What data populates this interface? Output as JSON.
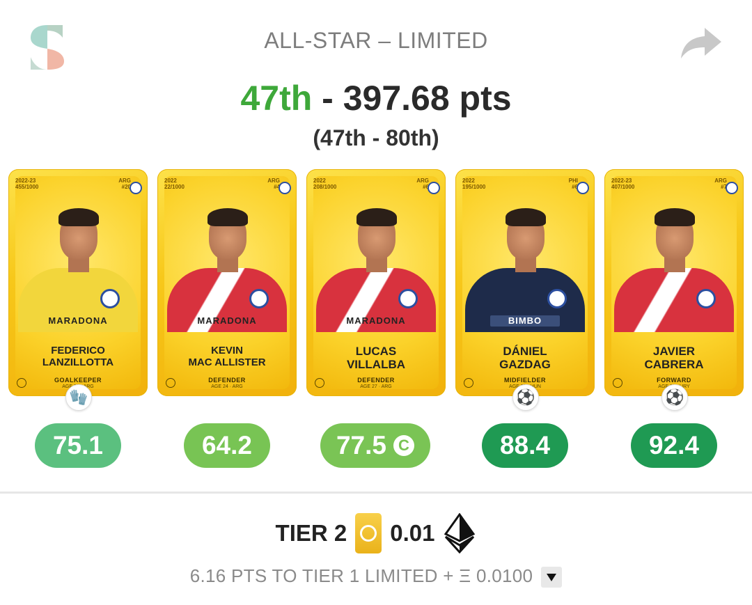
{
  "header": {
    "title": "ALL-STAR – LIMITED",
    "rank": "47th",
    "separator": " - ",
    "points": "397.68 pts",
    "range": "(47th - 80th)"
  },
  "cards": [
    {
      "season": "2022-23",
      "serial": "455/1000",
      "nation": "ARG",
      "number": "#20",
      "name_line1": "FEDERICO",
      "name_line2": "LANZILLOTTA",
      "position": "GOALKEEPER",
      "age": "AGE 32 · ARG",
      "kit": "yellow",
      "sponsor": "MARADONA",
      "score": "75.1",
      "score_color": "#5bc07f",
      "sub_icon": "🧤"
    },
    {
      "season": "2022",
      "serial": "22/1000",
      "nation": "ARG",
      "number": "#4",
      "name_line1": "KEVIN",
      "name_line2": "MAC ALLISTER",
      "position": "DEFENDER",
      "age": "AGE 24 · ARG",
      "kit": "red",
      "sponsor": "MARADONA",
      "score": "64.2",
      "score_color": "#78c454"
    },
    {
      "season": "2022",
      "serial": "208/1000",
      "nation": "ARG",
      "number": "#6",
      "name_line1": "LUCAS",
      "name_line2": "VILLALBA",
      "position": "DEFENDER",
      "age": "AGE 27 · ARG",
      "kit": "red",
      "sponsor": "MARADONA",
      "score": "77.5",
      "score_color": "#7ac455",
      "captain": "C"
    },
    {
      "season": "2022",
      "serial": "195/1000",
      "nation": "PHI",
      "number": "#6",
      "name_line1": "DÁNIEL",
      "name_line2": "GAZDAG",
      "position": "MIDFIELDER",
      "age": "AGE 27 · HUN",
      "kit": "navy",
      "sponsor": "BIMBO",
      "score": "88.4",
      "score_color": "#1f9a53",
      "sub_icon": "⚽"
    },
    {
      "season": "2022-23",
      "serial": "407/1000",
      "nation": "ARG",
      "number": "#7",
      "name_line1": "JAVIER",
      "name_line2": "CABRERA",
      "position": "FORWARD",
      "age": "AGE 31 · URY",
      "kit": "red",
      "sponsor": "",
      "score": "92.4",
      "score_color": "#1f9a53",
      "sub_icon": "⚽"
    }
  ],
  "footer": {
    "tier": "TIER 2",
    "reward": "0.01",
    "next_tier": "6.16 PTS TO TIER 1 LIMITED + Ξ 0.0100"
  },
  "colors": {
    "rank": "#3ea83a",
    "card_gold": "#f7c81a"
  }
}
